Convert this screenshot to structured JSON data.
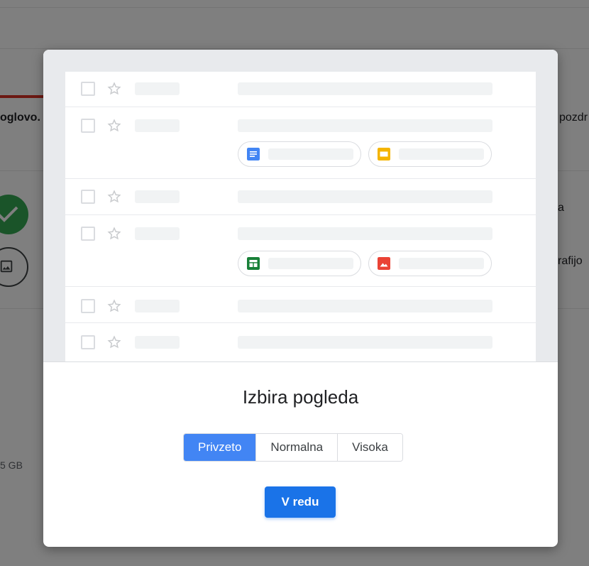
{
  "background": {
    "subject_fragment": "oglovo.",
    "greeting_fragment": "pozdr",
    "item_fragment_1": "a",
    "item_fragment_2": "rafijo",
    "storage_fragment": "5 GB"
  },
  "dialog": {
    "title": "Izbira pogleda",
    "options": [
      {
        "label": "Privzeto",
        "selected": true
      },
      {
        "label": "Normalna",
        "selected": false
      },
      {
        "label": "Visoka",
        "selected": false
      }
    ],
    "ok_label": "V redu"
  },
  "icons": {
    "docs": "docs-icon",
    "slides": "slides-icon",
    "sheets": "sheets-icon",
    "photo": "photo-icon",
    "checkbox": "checkbox-icon",
    "star": "star-icon"
  },
  "colors": {
    "accent": "#1a73e8",
    "selected_toggle": "#4285f4",
    "docs": "#4285f4",
    "slides": "#f4b400",
    "sheets": "#188038",
    "photo": "#ea4335"
  }
}
